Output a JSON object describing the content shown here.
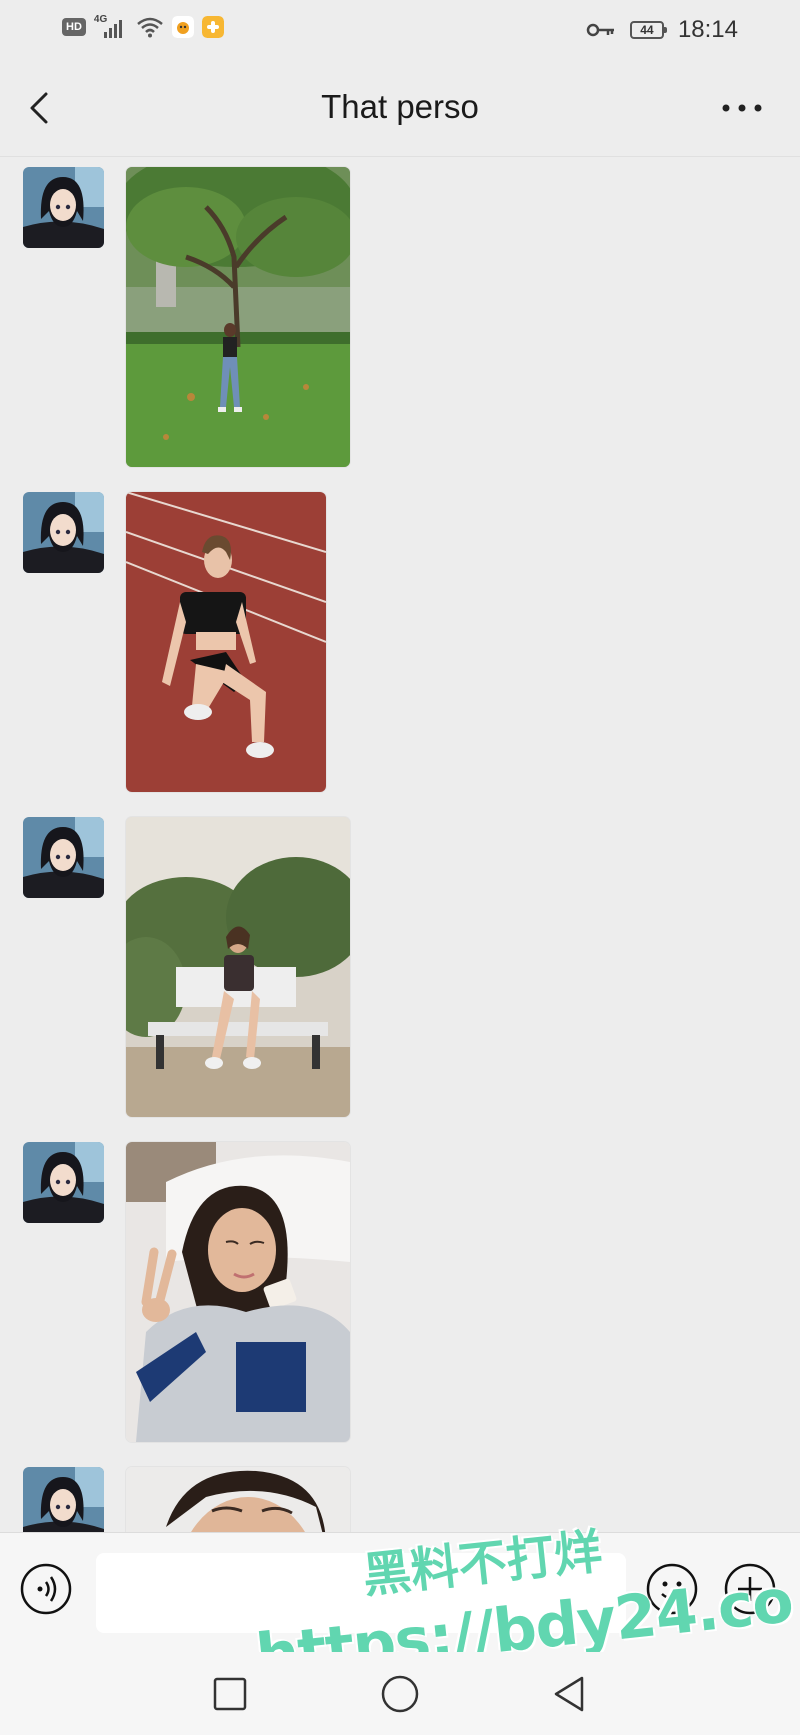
{
  "status_bar": {
    "hd_label": "HD",
    "network_label": "4G",
    "battery_level": "44",
    "time": "18:14"
  },
  "header": {
    "title": "That perso",
    "back_icon": "chevron-left-icon",
    "more_icon": "more-horizontal-icon"
  },
  "messages": [
    {
      "sender": "contact",
      "type": "image",
      "subject": "woman-under-tree"
    },
    {
      "sender": "contact",
      "type": "image",
      "subject": "woman-on-track"
    },
    {
      "sender": "contact",
      "type": "image",
      "subject": "woman-on-bench"
    },
    {
      "sender": "contact",
      "type": "image",
      "subject": "woman-lying-bed"
    },
    {
      "sender": "contact",
      "type": "image",
      "subject": "woman-close-up"
    }
  ],
  "input_bar": {
    "placeholder": "",
    "voice_icon": "voice-icon",
    "emoji_icon": "emoji-icon",
    "plus_icon": "plus-circle-icon"
  },
  "watermark": {
    "line1": "黑料不打烊",
    "line2": "https://bdy24.co"
  },
  "system_nav": {
    "recent_icon": "square-icon",
    "home_icon": "circle-icon",
    "back_icon": "triangle-back-icon"
  },
  "colors": {
    "background": "#ededed",
    "watermark": "#61d6b0"
  }
}
